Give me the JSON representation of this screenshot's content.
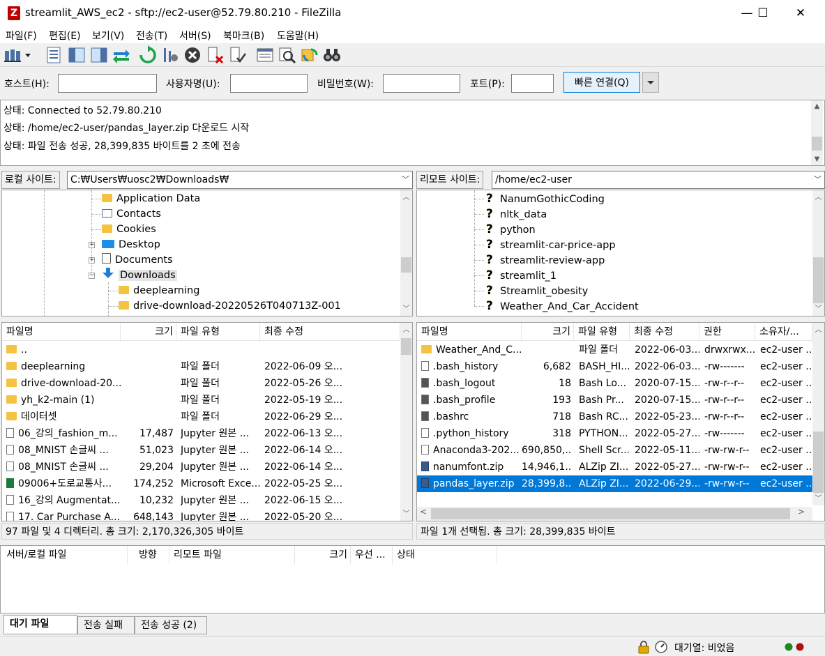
{
  "window": {
    "title": "streamlit_AWS_ec2 - sftp://ec2-user@52.79.80.210 - FileZilla",
    "app_icon": "Z",
    "minimize": "—",
    "maximize": "☐",
    "close": "✕"
  },
  "menu": [
    "파일(F)",
    "편집(E)",
    "보기(V)",
    "전송(T)",
    "서버(S)",
    "북마크(B)",
    "도움말(H)"
  ],
  "quickconnect": {
    "host_label": "호스트(H):",
    "user_label": "사용자명(U):",
    "pass_label": "비밀번호(W):",
    "port_label": "포트(P):",
    "host_value": "",
    "user_value": "",
    "pass_value": "",
    "port_value": "",
    "button_label": "빠른 연결(Q)"
  },
  "log": [
    "상태:  Connected to 52.79.80.210",
    "상태:  /home/ec2-user/pandas_layer.zip 다운로드 시작",
    "상태:  파일 전송 성공, 28,399,835 바이트를 2 초에 전송"
  ],
  "local": {
    "site_label": "로컬 사이트:",
    "path": "C:₩Users₩uosc2₩Downloads₩",
    "tree": [
      {
        "label": "Application Data",
        "icon": "folder-shortcut"
      },
      {
        "label": "Contacts",
        "icon": "contacts"
      },
      {
        "label": "Cookies",
        "icon": "folder-shortcut"
      },
      {
        "label": "Desktop",
        "icon": "desktop"
      },
      {
        "label": "Documents",
        "icon": "documents"
      },
      {
        "label": "Downloads",
        "icon": "downloads"
      },
      {
        "label": "deeplearning",
        "icon": "folder"
      },
      {
        "label": "drive-download-20220526T040713Z-001",
        "icon": "folder"
      }
    ],
    "columns": [
      "파일명",
      "크기",
      "파일 유형",
      "최종 수정"
    ],
    "files": [
      {
        "name": "..",
        "size": "",
        "type": "",
        "modified": "",
        "icon": "folder"
      },
      {
        "name": "deeplearning",
        "size": "",
        "type": "파일 폴더",
        "modified": "2022-06-09 오...",
        "icon": "folder"
      },
      {
        "name": "drive-download-20...",
        "size": "",
        "type": "파일 폴더",
        "modified": "2022-05-26 오...",
        "icon": "folder"
      },
      {
        "name": "yh_k2-main (1)",
        "size": "",
        "type": "파일 폴더",
        "modified": "2022-05-19 오...",
        "icon": "folder"
      },
      {
        "name": "데이터셋",
        "size": "",
        "type": "파일 폴더",
        "modified": "2022-06-29 오...",
        "icon": "folder"
      },
      {
        "name": "06_강의_fashion_m...",
        "size": "17,487",
        "type": "Jupyter 원본 ...",
        "modified": "2022-06-13 오...",
        "icon": "file"
      },
      {
        "name": "08_MNIST 손글씨 ...",
        "size": "51,023",
        "type": "Jupyter 원본 ...",
        "modified": "2022-06-14 오...",
        "icon": "file"
      },
      {
        "name": "08_MNIST 손글씨 ...",
        "size": "29,204",
        "type": "Jupyter 원본 ...",
        "modified": "2022-06-14 오...",
        "icon": "file"
      },
      {
        "name": "09006+도로교통사...",
        "size": "174,252",
        "type": "Microsoft Exce...",
        "modified": "2022-05-25 오...",
        "icon": "excel"
      },
      {
        "name": "16_강의 Augmentat...",
        "size": "10,232",
        "type": "Jupyter 원본 ...",
        "modified": "2022-06-15 오...",
        "icon": "file"
      },
      {
        "name": "17. Car Purchase A...",
        "size": "648,143",
        "type": "Jupyter 원본 ...",
        "modified": "2022-05-20 오...",
        "icon": "file"
      }
    ],
    "status": "97 파일 및 4 디렉터리. 총 크기: 2,170,326,305 바이트"
  },
  "remote": {
    "site_label": "리모트 사이트:",
    "path": "/home/ec2-user",
    "tree": [
      "NanumGothicCoding",
      "nltk_data",
      "python",
      "streamlit-car-price-app",
      "streamlit-review-app",
      "streamlit_1",
      "Streamlit_obesity",
      "Weather_And_Car_Accident"
    ],
    "columns": [
      "파일명",
      "크기",
      "파일 유형",
      "최종 수정",
      "권한",
      "소유자/..."
    ],
    "files": [
      {
        "name": "Weather_And_C...",
        "size": "",
        "type": "파일 폴더",
        "modified": "2022-06-03...",
        "perm": "drwxrwx...",
        "owner": "ec2-user ...",
        "icon": "folder"
      },
      {
        "name": ".bash_history",
        "size": "6,682",
        "type": "BASH_HI...",
        "modified": "2022-06-03...",
        "perm": "-rw-------",
        "owner": "ec2-user ...",
        "icon": "file"
      },
      {
        "name": ".bash_logout",
        "size": "18",
        "type": "Bash Lo...",
        "modified": "2020-07-15...",
        "perm": "-rw-r--r--",
        "owner": "ec2-user ...",
        "icon": "dark"
      },
      {
        "name": ".bash_profile",
        "size": "193",
        "type": "Bash Pr...",
        "modified": "2020-07-15...",
        "perm": "-rw-r--r--",
        "owner": "ec2-user ...",
        "icon": "dark"
      },
      {
        "name": ".bashrc",
        "size": "718",
        "type": "Bash RC...",
        "modified": "2022-05-23...",
        "perm": "-rw-r--r--",
        "owner": "ec2-user ...",
        "icon": "dark"
      },
      {
        "name": ".python_history",
        "size": "318",
        "type": "PYTHON...",
        "modified": "2022-05-27...",
        "perm": "-rw-------",
        "owner": "ec2-user ...",
        "icon": "file"
      },
      {
        "name": "Anaconda3-202...",
        "size": "690,850,...",
        "type": "Shell Scr...",
        "modified": "2022-05-11...",
        "perm": "-rw-rw-r--",
        "owner": "ec2-user ...",
        "icon": "file"
      },
      {
        "name": "nanumfont.zip",
        "size": "14,946,1...",
        "type": "ALZip ZI...",
        "modified": "2022-05-27...",
        "perm": "-rw-rw-r--",
        "owner": "ec2-user ...",
        "icon": "zip"
      },
      {
        "name": "pandas_layer.zip",
        "size": "28,399,8...",
        "type": "ALZip ZI...",
        "modified": "2022-06-29...",
        "perm": "-rw-rw-r--",
        "owner": "ec2-user ...",
        "icon": "zip",
        "selected": true
      }
    ],
    "status": "파일 1개 선택됨. 총 크기: 28,399,835 바이트"
  },
  "queue": {
    "columns": [
      "서버/로컬 파일",
      "방향",
      "리모트 파일",
      "크기",
      "우선 ...",
      "상태"
    ]
  },
  "tabs": [
    "대기 파일",
    "전송 실패",
    "전송 성공 (2)"
  ],
  "statusbar": {
    "queue_text": "대기열: 비었음"
  },
  "colors": {
    "selection": "#0078d7",
    "folder": "#f5c342",
    "accent": "#0078d7"
  }
}
